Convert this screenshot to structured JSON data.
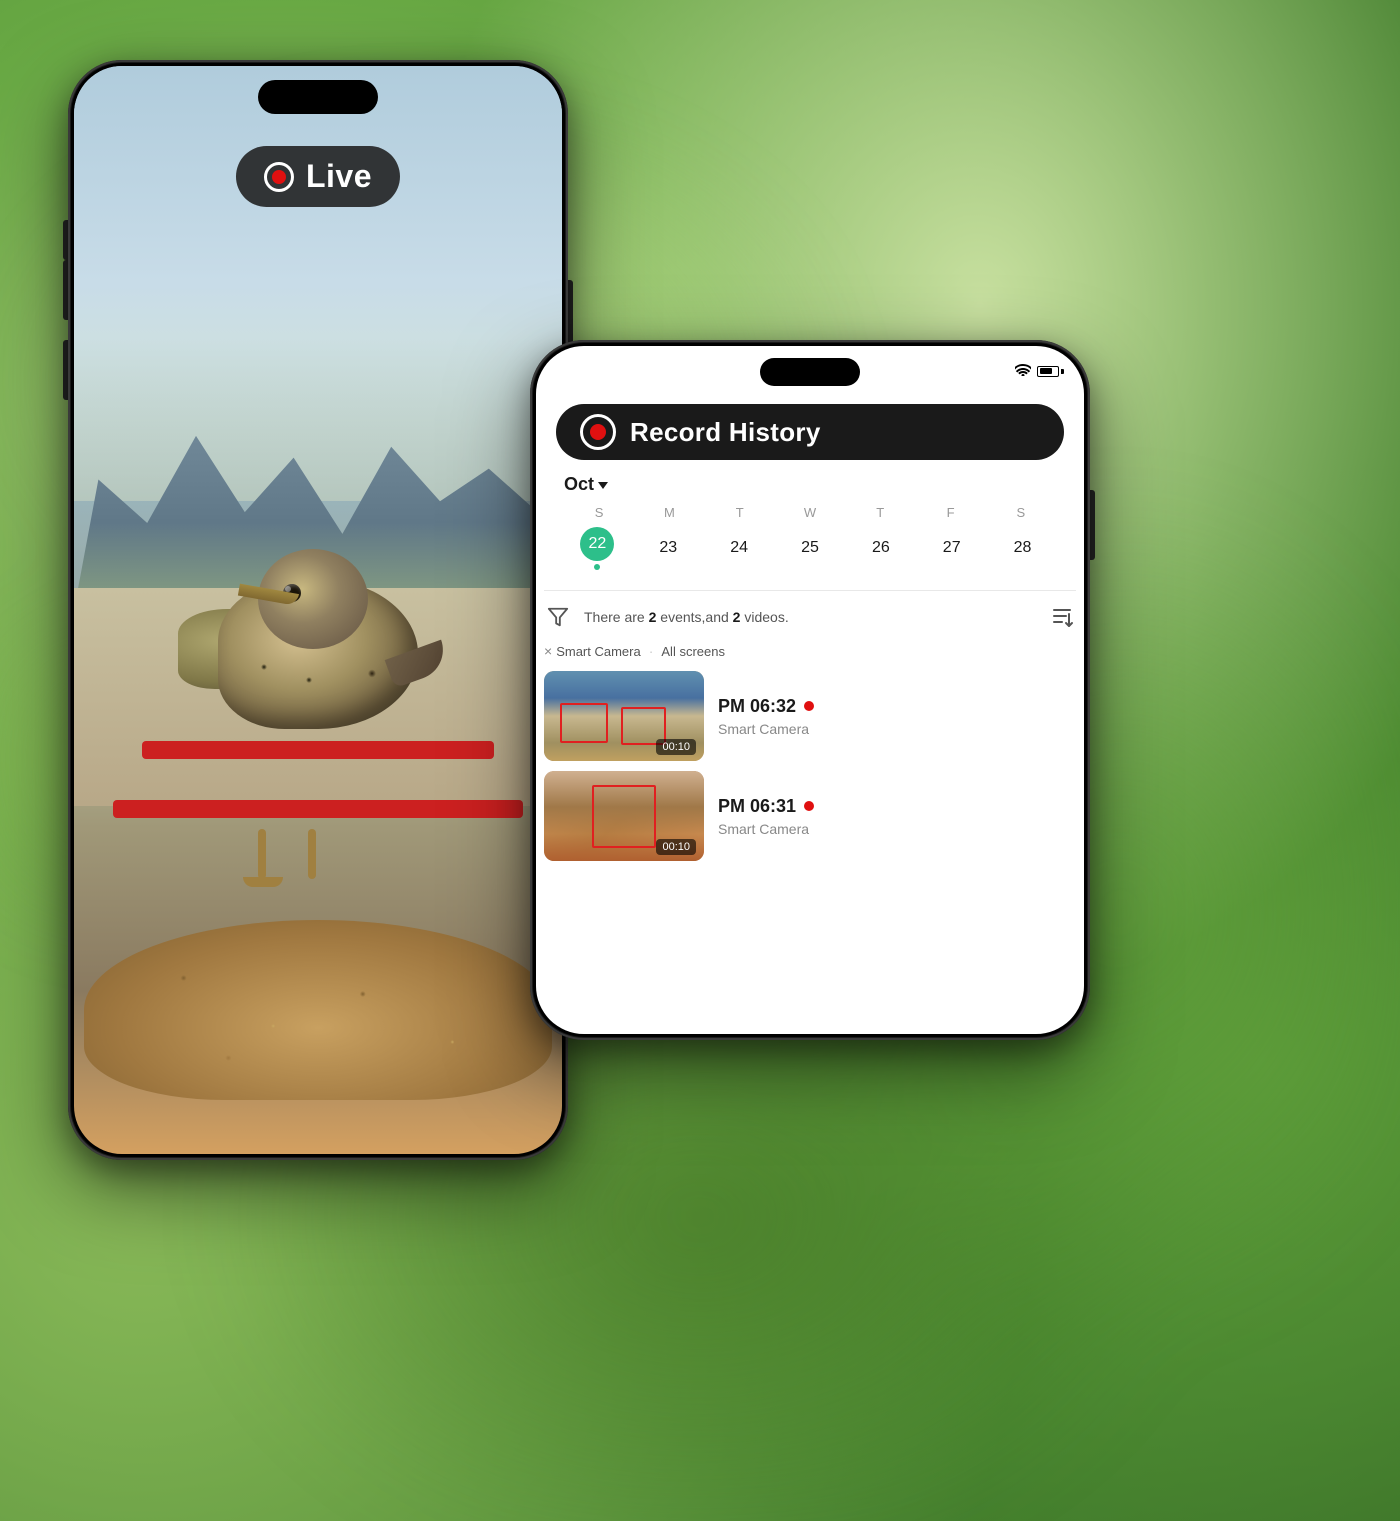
{
  "background": {
    "color1": "#6aaa45",
    "color2": "#4a8a30"
  },
  "left_phone": {
    "live_badge": {
      "label": "Live"
    }
  },
  "right_phone": {
    "title": "Record History",
    "month": "Oct",
    "calendar": {
      "day_labels": [
        "S",
        "M",
        "T",
        "W",
        "T",
        "F",
        "S"
      ],
      "dates": [
        "22",
        "23",
        "24",
        "25",
        "26",
        "27",
        "28"
      ],
      "today_index": 0,
      "dot_index": 0
    },
    "filter_text_prefix": "There are",
    "event_count": "2",
    "filter_text_mid": "events,and",
    "video_count": "2",
    "filter_text_suffix": "videos.",
    "tag_camera": "Smart Camera",
    "tag_screen": "All screens",
    "videos": [
      {
        "time": "PM 06:32",
        "camera": "Smart Camera",
        "duration": "00:10"
      },
      {
        "time": "PM 06:31",
        "camera": "Smart Camera",
        "duration": "00:10"
      }
    ],
    "status": {
      "battery_text": "",
      "signal": "●●●"
    }
  }
}
